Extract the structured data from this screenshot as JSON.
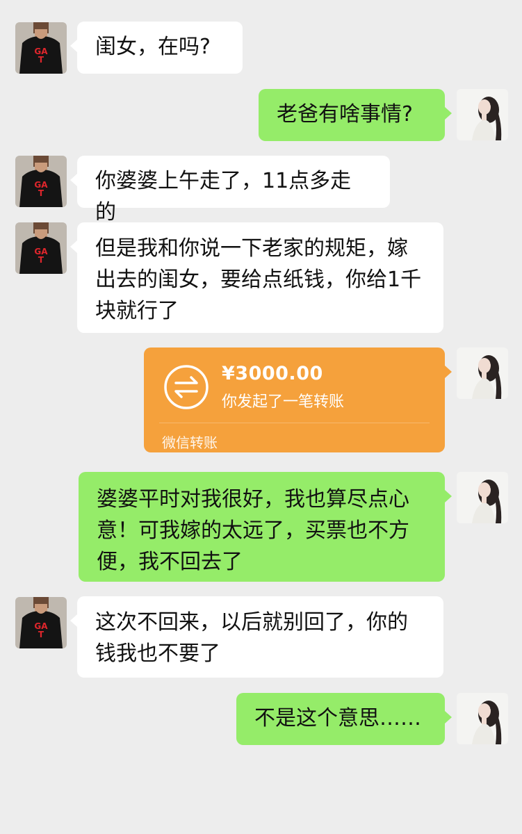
{
  "contacts": {
    "father_avatar": "man-in-black-tshirt-avatar",
    "self_avatar": "woman-portrait-avatar"
  },
  "messages": [
    {
      "sender": "father",
      "text": "闺女，在吗?"
    },
    {
      "sender": "self",
      "text": "老爸有啥事情?"
    },
    {
      "sender": "father",
      "text": "你婆婆上午走了，11点多走的"
    },
    {
      "sender": "father",
      "text": "但是我和你说一下老家的规矩，嫁出去的闺女，要给点纸钱，你给1千块就行了"
    },
    {
      "sender": "self",
      "type": "transfer",
      "amount": "¥3000.00",
      "description": "你发起了一笔转账",
      "footer": "微信转账"
    },
    {
      "sender": "self",
      "text": "婆婆平时对我很好，我也算尽点心意！可我嫁的太远了，买票也不方便，我不回去了"
    },
    {
      "sender": "father",
      "text": "这次不回来，以后就别回了，你的钱我也不要了"
    },
    {
      "sender": "self",
      "text": "不是这个意思……"
    }
  ],
  "colors": {
    "background": "#ededed",
    "bubble_left": "#ffffff",
    "bubble_right": "#95ec69",
    "transfer": "#f5a13c"
  }
}
